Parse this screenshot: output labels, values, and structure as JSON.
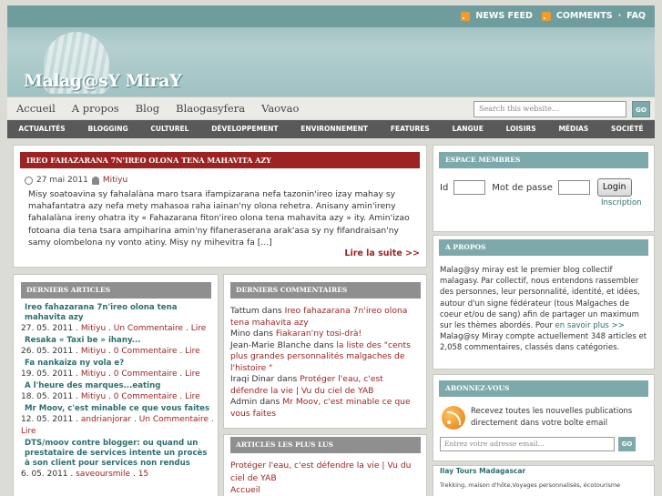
{
  "header": {
    "news_feed": "NEWS FEED",
    "comments": "COMMENTS",
    "separator": "·",
    "faq": "FAQ",
    "logo": "Malag@sY MiraY"
  },
  "nav": {
    "items": [
      "Accueil",
      "A propos",
      "Blog",
      "Blaogasyfera",
      "Vaovao"
    ],
    "search_placeholder": "Search this website...",
    "search_button": "GO"
  },
  "categories": [
    "ACTUALITÉS",
    "BLOGGING",
    "CULTUREL",
    "DÉVELOPPEMENT",
    "ENVIRONNEMENT",
    "FEATURES",
    "LANGUE",
    "LOISIRS",
    "MÉDIAS",
    "SOCIÉTÉ"
  ],
  "featured": {
    "title": "IREO FAHAZARANA 7N'IREO OLONA TENA MAHAVITA AZY",
    "date": "27 mai 2011",
    "author": "Mitiyu",
    "excerpt": "Misy soatoavina sy fahalalàna maro tsara ifampizarana nefa tazonin'ireo izay mahay sy mahafantatra azy nefa mety mahasoa raha iainan'ny olona rehetra. Anisany amin'ireny fahalalàna ireny ohatra ity « Fahazarana fiton'ireo olona tena mahavita azy » ity. Amin'izao fotoana dia tena tsara ampiharina amin'ny fifaneraserana arak'asa sy ny fifandraisan'ny samy olombelona ny vonto atiny. Misy ny mihevitra fa [...]",
    "read_more": "Lire la suite >>"
  },
  "recent_posts": {
    "heading": "DERNIERS ARTICLES",
    "items": [
      {
        "title": "Ireo fahazarana 7n'ireo olona tena mahavita azy",
        "date": "27. 05. 2011",
        "author": "Mitiyu",
        "comments": "Un Commentaire",
        "more": "Lire"
      },
      {
        "title": "Resaka « Taxi be » ihany...",
        "date": "26. 05. 2011",
        "author": "Mitiyu",
        "comments": "0 Commentaire",
        "more": "Lire"
      },
      {
        "title": "Fa nankaiza ny vola e?",
        "date": "19. 05. 2011",
        "author": "Mitiyu",
        "comments": "0 Commentaire",
        "more": "Lire"
      },
      {
        "title": "A l'heure des marques...eating",
        "date": "18. 05. 2011",
        "author": "Mitiyu",
        "comments": "0 Commentaire",
        "more": "Lire"
      },
      {
        "title": "Mr Moov, c'est minable ce que vous faites",
        "date": "12. 05. 2011",
        "author": "andrianjorar",
        "comments": "Un Commentaire",
        "more": "Lire"
      },
      {
        "title": "DTS/moov contre blogger: ou quand un prestataire de services intente un procès à son client pour services non rendus",
        "date": "6. 05. 2011",
        "author": "saveoursmile",
        "comments": "15",
        "more": ""
      }
    ]
  },
  "recent_comments": {
    "heading": "DERNIERS COMMENTAIRES",
    "items": [
      {
        "who": "Tattum",
        "in": "dans",
        "post": "Ireo fahazarana 7n'ireo olona tena mahavita azy"
      },
      {
        "who": "Mino",
        "in": "dans",
        "post": "Fiakaran'ny tosi-drà!"
      },
      {
        "who": "Jean-Marie Blanche",
        "in": "dans",
        "post": "la liste des \"cents plus grandes personnalités malgaches de l'histoire \""
      },
      {
        "who": "Iraqi Dinar",
        "in": "dans",
        "post": "Protéger l'eau, c'est défendre la vie | Vu du ciel de YAB"
      },
      {
        "who": "Admin",
        "in": "dans",
        "post": "Mr Moov, c'est minable ce que vous faites"
      }
    ]
  },
  "popular": {
    "heading": "ARTICLES LES PLUS LUS",
    "items": [
      "Protéger l'eau, c'est défendre la vie | Vu du ciel de YAB",
      "Accueil"
    ]
  },
  "members": {
    "heading": "ESPACE MEMBRES",
    "id_label": "Id",
    "pass_label": "Mot de passe",
    "login_button": "Login",
    "register": "Inscription"
  },
  "about": {
    "heading": "A PROPOS",
    "text": "Malag@sy miray est le premier blog collectif malagasy. Par collectif, nous entendons rassembler des personnes, leur personnalité, identité, et idées, autour d'un signe fédérateur (tous Malgaches de coeur et/ou de sang) afin de partager un maximum sur les thèmes abordés. Pour",
    "link": "en savoir plus >>",
    "stats": "Malag@sy Miray compte actuellement 348 articles et 2,058 commentaires, classés dans catégories."
  },
  "subscribe": {
    "heading": "ABONNEZ-VOUS",
    "text": "Recevez toutes les nouvelles publications directement dans votre boîte email",
    "placeholder": "Entrez votre adresse email...",
    "button": "GO"
  },
  "ad": {
    "title": "Ilay Tours Madagascar",
    "desc": "Trekking, maison d'hôte,Voyages personnalisés, écotourisme"
  }
}
